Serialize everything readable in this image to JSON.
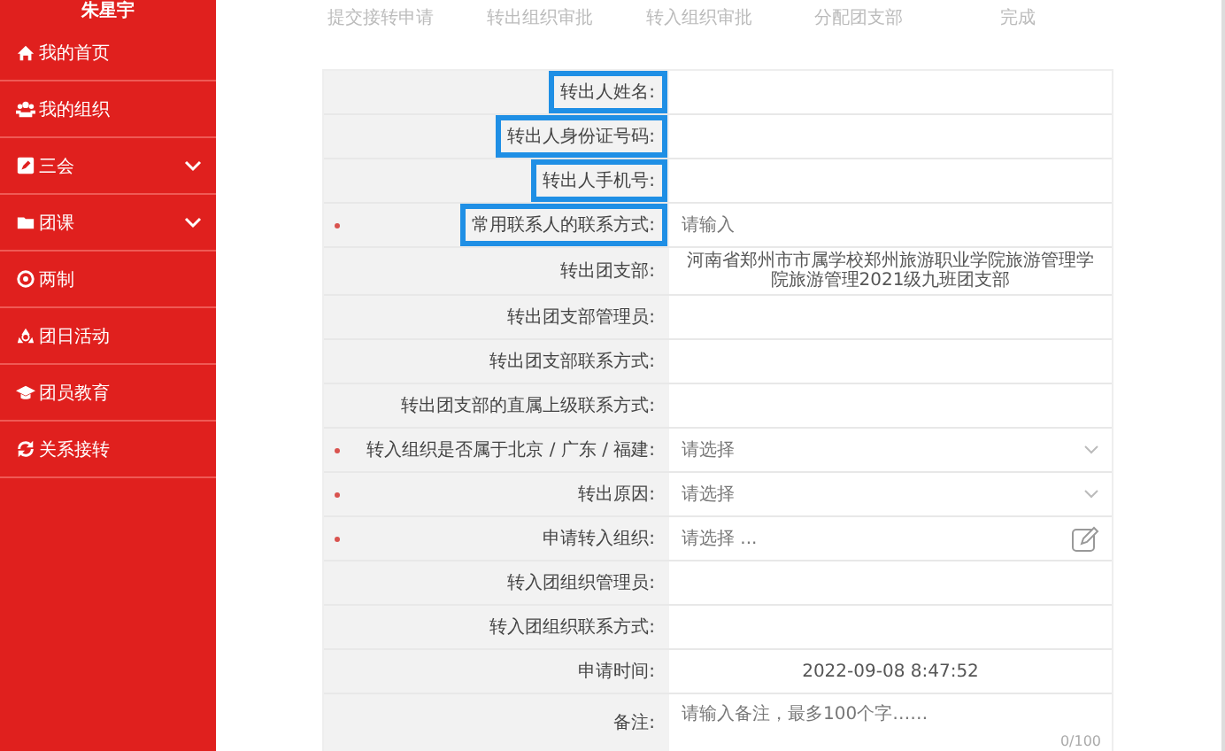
{
  "sidebar": {
    "user_name": "朱星宇",
    "items": [
      {
        "label": "我的首页",
        "expandable": false
      },
      {
        "label": "我的组织",
        "expandable": false
      },
      {
        "label": "三会",
        "expandable": true
      },
      {
        "label": "团课",
        "expandable": true
      },
      {
        "label": "两制",
        "expandable": false
      },
      {
        "label": "团日活动",
        "expandable": false
      },
      {
        "label": "团员教育",
        "expandable": false
      },
      {
        "label": "关系接转",
        "expandable": false
      }
    ]
  },
  "steps": [
    "提交接转申请",
    "转出组织审批",
    "转入组织审批",
    "分配团支部",
    "完成"
  ],
  "form": {
    "rows": [
      {
        "label": "转出人姓名:",
        "kind": "text",
        "required": false,
        "highlighted": true
      },
      {
        "label": "转出人身份证号码:",
        "kind": "text",
        "required": false,
        "highlighted": true
      },
      {
        "label": "转出人手机号:",
        "kind": "text",
        "required": false,
        "highlighted": true
      },
      {
        "label": "常用联系人的联系方式:",
        "kind": "input",
        "placeholder": "请输入",
        "required": true,
        "highlighted": true
      },
      {
        "label": "转出团支部:",
        "kind": "text",
        "value": "河南省郑州市市属学校郑州旅游职业学院旅游管理学院旅游管理2021级九班团支部",
        "required": false,
        "highlighted": false
      },
      {
        "label": "转出团支部管理员:",
        "kind": "text",
        "required": false,
        "highlighted": false
      },
      {
        "label": "转出团支部联系方式:",
        "kind": "text",
        "required": false,
        "highlighted": false
      },
      {
        "label": "转出团支部的直属上级联系方式:",
        "kind": "text",
        "required": false,
        "highlighted": false
      },
      {
        "label": "转入组织是否属于北京 / 广东 / 福建:",
        "kind": "select",
        "placeholder": "请选择",
        "required": true,
        "highlighted": false
      },
      {
        "label": "转出原因:",
        "kind": "select",
        "placeholder": "请选择",
        "required": true,
        "highlighted": false
      },
      {
        "label": "申请转入组织:",
        "kind": "picker",
        "placeholder": "请选择 ...",
        "required": true,
        "highlighted": false
      },
      {
        "label": "转入团组织管理员:",
        "kind": "text",
        "required": false,
        "highlighted": false
      },
      {
        "label": "转入团组织联系方式:",
        "kind": "text",
        "required": false,
        "highlighted": false
      },
      {
        "label": "申请时间:",
        "kind": "text",
        "value": "2022-09-08 8:47:52",
        "required": false,
        "highlighted": false
      },
      {
        "label": "备注:",
        "kind": "textarea",
        "placeholder": "请输入备注，最多100个字……",
        "counter": "0/100",
        "required": false,
        "highlighted": false
      }
    ]
  }
}
